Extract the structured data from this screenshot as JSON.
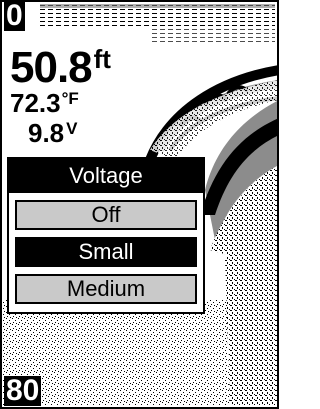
{
  "depth_scale": {
    "top": "0",
    "bottom": "80"
  },
  "readouts": {
    "depth_value": "50.8",
    "depth_unit": "ft",
    "temp_value": "72.3",
    "temp_unit": "°F",
    "voltage_value": "9.8",
    "voltage_unit": "V"
  },
  "menu": {
    "title": "Voltage",
    "items": [
      {
        "label": "Off",
        "selected": false
      },
      {
        "label": "Small",
        "selected": true
      },
      {
        "label": "Medium",
        "selected": false
      }
    ]
  }
}
